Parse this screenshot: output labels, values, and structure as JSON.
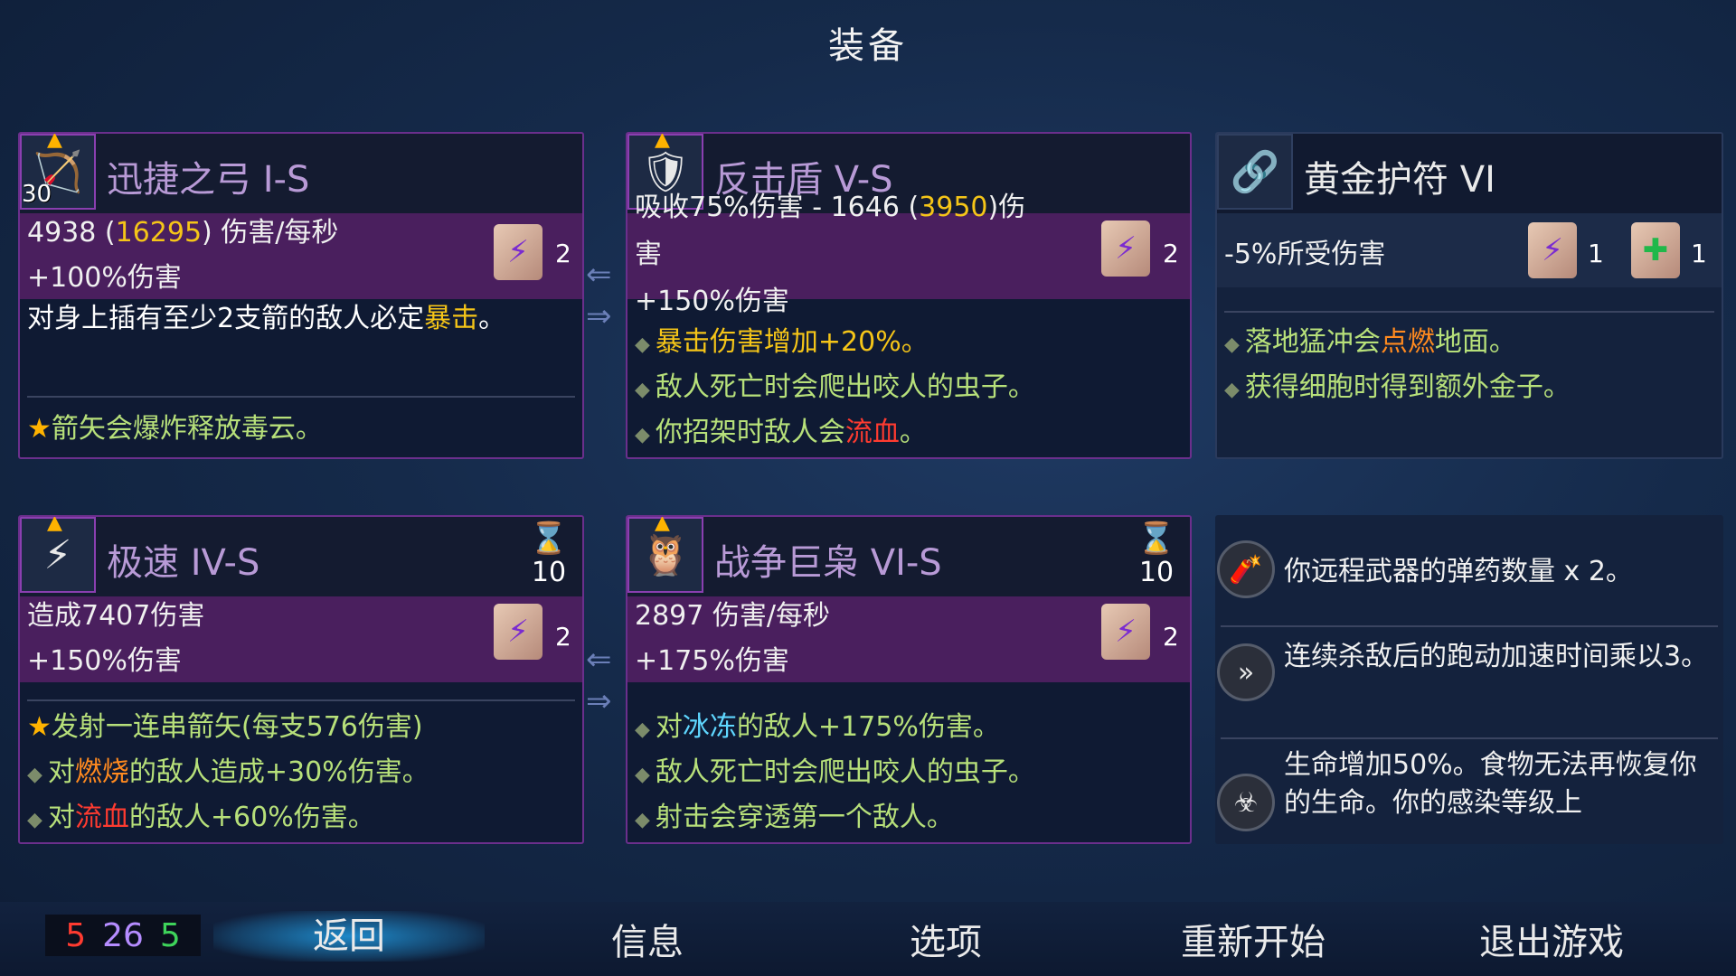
{
  "title": "装备",
  "cards": {
    "bow": {
      "icon": "bow-icon",
      "level": "30",
      "name": "迅捷之弓 I-S",
      "stat1_a": "4938 (",
      "stat1_gold": "16295",
      "stat1_b": ") 伤害/每秒",
      "stat2": "+100%伤害",
      "scroll_count": "2",
      "desc1_a": "对身上插有至少2支箭的敌人必定",
      "desc1_gold": "暴击",
      "desc1_b": "。",
      "desc2": "箭矢会爆炸释放毒云。"
    },
    "shield": {
      "icon": "shield-icon",
      "name": "反击盾 V-S",
      "stat1_a": "吸收75%伤害 - 1646 (",
      "stat1_gold": "3950",
      "stat1_b": ")伤",
      "stat1_c": "害",
      "stat2": "+150%伤害",
      "scroll_count": "2",
      "desc_a": "暴击伤害增加+20%。",
      "desc_b": "敌人死亡时会爬出咬人的虫子。",
      "desc_c_a": "你招架时敌人会",
      "desc_c_red": "流血",
      "desc_c_b": "。"
    },
    "amulet": {
      "icon": "amulet-icon",
      "name": "黄金护符 VI",
      "stat1": "-5%所受伤害",
      "scroll_count_1": "1",
      "scroll_count_2": "1",
      "desc_a_a": "落地猛冲会",
      "desc_a_orange": "点燃",
      "desc_a_b": "地面。",
      "desc_b": "获得细胞时得到额外金子。"
    },
    "speed": {
      "icon": "speed-icon",
      "name": "极速 IV-S",
      "cooldown": "10",
      "stat1": "造成7407伤害",
      "stat2": "+150%伤害",
      "scroll_count": "2",
      "desc_a": "发射一连串箭矢(每支576伤害)",
      "desc_b_a": "对",
      "desc_b_orange": "燃烧",
      "desc_b_b": "的敌人造成+30%伤害。",
      "desc_c_a": "对",
      "desc_c_red": "流血",
      "desc_c_b": "的敌人+60%伤害。"
    },
    "owl": {
      "icon": "owl-icon",
      "name": "战争巨枭 VI-S",
      "cooldown": "10",
      "stat1": "2897 伤害/每秒",
      "stat2": "+175%伤害",
      "scroll_count": "2",
      "desc_a_a": "对",
      "desc_a_cyan": "冰冻",
      "desc_a_b": "的敌人+175%伤害。",
      "desc_b": "敌人死亡时会爬出咬人的虫子。",
      "desc_c": "射击会穿透第一个敌人。"
    }
  },
  "mutations": [
    {
      "icon": "ammo-icon",
      "text": "你远程武器的弹药数量 x 2。"
    },
    {
      "icon": "speed-boost-icon",
      "text": "连续杀敌后的跑动加速时间乘以3。"
    },
    {
      "icon": "infection-icon",
      "text": "生命增加50%。食物无法再恢复你的生命。你的感染等级上"
    }
  ],
  "stats_counter": {
    "red": "5",
    "purple": "26",
    "green": "5",
    "colors": {
      "red": "#ff3b30",
      "purple": "#b58cff",
      "green": "#3ed35a"
    }
  },
  "menu": {
    "back": "返回",
    "info": "信息",
    "options": "选项",
    "restart": "重新开始",
    "quit": "退出游戏"
  }
}
